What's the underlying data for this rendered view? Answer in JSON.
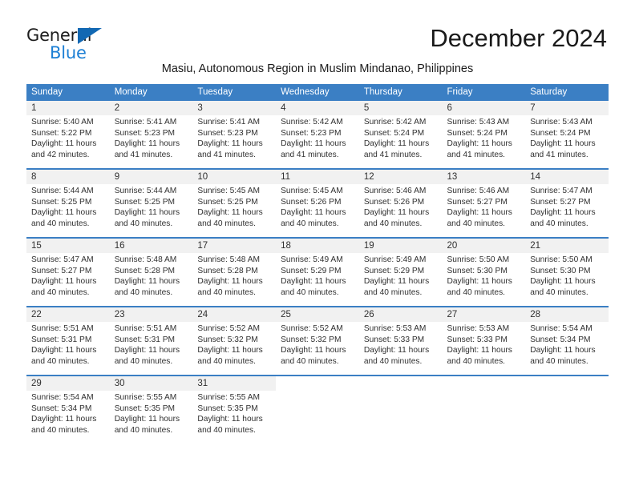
{
  "brand": {
    "name_line1": "General",
    "name_line2": "Blue",
    "triangle_color": "#1268b3",
    "blue_text_color": "#1c7fd4"
  },
  "header": {
    "month_title": "December 2024",
    "location": "Masiu, Autonomous Region in Muslim Mindanao, Philippines"
  },
  "theme": {
    "header_band": "#3b7fc4",
    "daynum_band": "#f1f1f1",
    "text": "#303030"
  },
  "calendar": {
    "weekday_headers": [
      "Sunday",
      "Monday",
      "Tuesday",
      "Wednesday",
      "Thursday",
      "Friday",
      "Saturday"
    ],
    "weeks": [
      [
        {
          "day": "1",
          "sunrise": "Sunrise: 5:40 AM",
          "sunset": "Sunset: 5:22 PM",
          "daylight_1": "Daylight: 11 hours",
          "daylight_2": "and 42 minutes."
        },
        {
          "day": "2",
          "sunrise": "Sunrise: 5:41 AM",
          "sunset": "Sunset: 5:23 PM",
          "daylight_1": "Daylight: 11 hours",
          "daylight_2": "and 41 minutes."
        },
        {
          "day": "3",
          "sunrise": "Sunrise: 5:41 AM",
          "sunset": "Sunset: 5:23 PM",
          "daylight_1": "Daylight: 11 hours",
          "daylight_2": "and 41 minutes."
        },
        {
          "day": "4",
          "sunrise": "Sunrise: 5:42 AM",
          "sunset": "Sunset: 5:23 PM",
          "daylight_1": "Daylight: 11 hours",
          "daylight_2": "and 41 minutes."
        },
        {
          "day": "5",
          "sunrise": "Sunrise: 5:42 AM",
          "sunset": "Sunset: 5:24 PM",
          "daylight_1": "Daylight: 11 hours",
          "daylight_2": "and 41 minutes."
        },
        {
          "day": "6",
          "sunrise": "Sunrise: 5:43 AM",
          "sunset": "Sunset: 5:24 PM",
          "daylight_1": "Daylight: 11 hours",
          "daylight_2": "and 41 minutes."
        },
        {
          "day": "7",
          "sunrise": "Sunrise: 5:43 AM",
          "sunset": "Sunset: 5:24 PM",
          "daylight_1": "Daylight: 11 hours",
          "daylight_2": "and 41 minutes."
        }
      ],
      [
        {
          "day": "8",
          "sunrise": "Sunrise: 5:44 AM",
          "sunset": "Sunset: 5:25 PM",
          "daylight_1": "Daylight: 11 hours",
          "daylight_2": "and 40 minutes."
        },
        {
          "day": "9",
          "sunrise": "Sunrise: 5:44 AM",
          "sunset": "Sunset: 5:25 PM",
          "daylight_1": "Daylight: 11 hours",
          "daylight_2": "and 40 minutes."
        },
        {
          "day": "10",
          "sunrise": "Sunrise: 5:45 AM",
          "sunset": "Sunset: 5:25 PM",
          "daylight_1": "Daylight: 11 hours",
          "daylight_2": "and 40 minutes."
        },
        {
          "day": "11",
          "sunrise": "Sunrise: 5:45 AM",
          "sunset": "Sunset: 5:26 PM",
          "daylight_1": "Daylight: 11 hours",
          "daylight_2": "and 40 minutes."
        },
        {
          "day": "12",
          "sunrise": "Sunrise: 5:46 AM",
          "sunset": "Sunset: 5:26 PM",
          "daylight_1": "Daylight: 11 hours",
          "daylight_2": "and 40 minutes."
        },
        {
          "day": "13",
          "sunrise": "Sunrise: 5:46 AM",
          "sunset": "Sunset: 5:27 PM",
          "daylight_1": "Daylight: 11 hours",
          "daylight_2": "and 40 minutes."
        },
        {
          "day": "14",
          "sunrise": "Sunrise: 5:47 AM",
          "sunset": "Sunset: 5:27 PM",
          "daylight_1": "Daylight: 11 hours",
          "daylight_2": "and 40 minutes."
        }
      ],
      [
        {
          "day": "15",
          "sunrise": "Sunrise: 5:47 AM",
          "sunset": "Sunset: 5:27 PM",
          "daylight_1": "Daylight: 11 hours",
          "daylight_2": "and 40 minutes."
        },
        {
          "day": "16",
          "sunrise": "Sunrise: 5:48 AM",
          "sunset": "Sunset: 5:28 PM",
          "daylight_1": "Daylight: 11 hours",
          "daylight_2": "and 40 minutes."
        },
        {
          "day": "17",
          "sunrise": "Sunrise: 5:48 AM",
          "sunset": "Sunset: 5:28 PM",
          "daylight_1": "Daylight: 11 hours",
          "daylight_2": "and 40 minutes."
        },
        {
          "day": "18",
          "sunrise": "Sunrise: 5:49 AM",
          "sunset": "Sunset: 5:29 PM",
          "daylight_1": "Daylight: 11 hours",
          "daylight_2": "and 40 minutes."
        },
        {
          "day": "19",
          "sunrise": "Sunrise: 5:49 AM",
          "sunset": "Sunset: 5:29 PM",
          "daylight_1": "Daylight: 11 hours",
          "daylight_2": "and 40 minutes."
        },
        {
          "day": "20",
          "sunrise": "Sunrise: 5:50 AM",
          "sunset": "Sunset: 5:30 PM",
          "daylight_1": "Daylight: 11 hours",
          "daylight_2": "and 40 minutes."
        },
        {
          "day": "21",
          "sunrise": "Sunrise: 5:50 AM",
          "sunset": "Sunset: 5:30 PM",
          "daylight_1": "Daylight: 11 hours",
          "daylight_2": "and 40 minutes."
        }
      ],
      [
        {
          "day": "22",
          "sunrise": "Sunrise: 5:51 AM",
          "sunset": "Sunset: 5:31 PM",
          "daylight_1": "Daylight: 11 hours",
          "daylight_2": "and 40 minutes."
        },
        {
          "day": "23",
          "sunrise": "Sunrise: 5:51 AM",
          "sunset": "Sunset: 5:31 PM",
          "daylight_1": "Daylight: 11 hours",
          "daylight_2": "and 40 minutes."
        },
        {
          "day": "24",
          "sunrise": "Sunrise: 5:52 AM",
          "sunset": "Sunset: 5:32 PM",
          "daylight_1": "Daylight: 11 hours",
          "daylight_2": "and 40 minutes."
        },
        {
          "day": "25",
          "sunrise": "Sunrise: 5:52 AM",
          "sunset": "Sunset: 5:32 PM",
          "daylight_1": "Daylight: 11 hours",
          "daylight_2": "and 40 minutes."
        },
        {
          "day": "26",
          "sunrise": "Sunrise: 5:53 AM",
          "sunset": "Sunset: 5:33 PM",
          "daylight_1": "Daylight: 11 hours",
          "daylight_2": "and 40 minutes."
        },
        {
          "day": "27",
          "sunrise": "Sunrise: 5:53 AM",
          "sunset": "Sunset: 5:33 PM",
          "daylight_1": "Daylight: 11 hours",
          "daylight_2": "and 40 minutes."
        },
        {
          "day": "28",
          "sunrise": "Sunrise: 5:54 AM",
          "sunset": "Sunset: 5:34 PM",
          "daylight_1": "Daylight: 11 hours",
          "daylight_2": "and 40 minutes."
        }
      ],
      [
        {
          "day": "29",
          "sunrise": "Sunrise: 5:54 AM",
          "sunset": "Sunset: 5:34 PM",
          "daylight_1": "Daylight: 11 hours",
          "daylight_2": "and 40 minutes."
        },
        {
          "day": "30",
          "sunrise": "Sunrise: 5:55 AM",
          "sunset": "Sunset: 5:35 PM",
          "daylight_1": "Daylight: 11 hours",
          "daylight_2": "and 40 minutes."
        },
        {
          "day": "31",
          "sunrise": "Sunrise: 5:55 AM",
          "sunset": "Sunset: 5:35 PM",
          "daylight_1": "Daylight: 11 hours",
          "daylight_2": "and 40 minutes."
        },
        null,
        null,
        null,
        null
      ]
    ]
  }
}
